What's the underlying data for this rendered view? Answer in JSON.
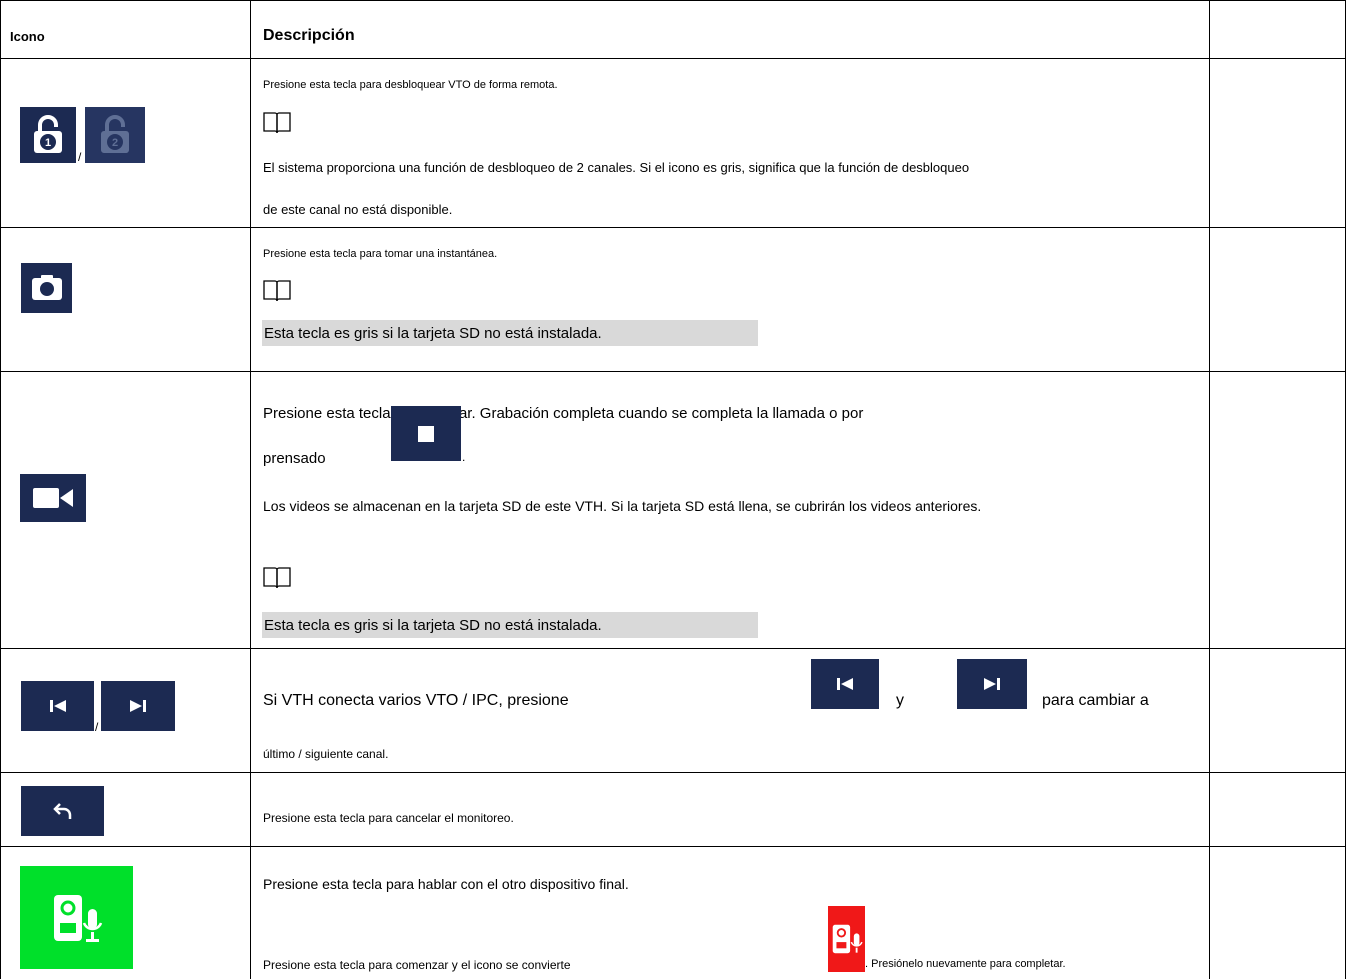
{
  "header": {
    "icon_col": "Icono",
    "desc_col": "Descripción"
  },
  "rows": [
    {
      "sep": "/",
      "lines": [
        "Presione esta tecla para desbloquear VTO de forma remota.",
        "El sistema proporciona una función de desbloqueo de 2 canales. Si el icono es gris, significa que la función de desbloqueo",
        "de este canal no está disponible."
      ],
      "icons": [
        "unlock-1-icon",
        "unlock-2-icon"
      ]
    },
    {
      "lines": [
        "Presione esta tecla para tomar una instantánea.",
        "Esta tecla es gris si la tarjeta SD no está instalada."
      ],
      "icons": [
        "camera-icon"
      ]
    },
    {
      "lines": [
        "Presione esta tecla para grabar. Grabación completa cuando se completa la llamada o por",
        "prensado",
        ".",
        "Los videos se almacenan en la tarjeta SD de este VTH. Si la tarjeta SD está llena, se cubrirán los videos anteriores.",
        "Esta tecla es gris si la tarjeta SD no está instalada."
      ],
      "icons": [
        "video-record-icon",
        "stop-icon"
      ]
    },
    {
      "sep": "/",
      "lines": [
        "Si VTH conecta varios VTO / IPC, presione",
        "y",
        "para cambiar a",
        "último / siguiente canal."
      ],
      "icons": [
        "previous-icon",
        "next-icon"
      ]
    },
    {
      "lines": [
        "Presione esta tecla para cancelar el monitoreo."
      ],
      "icons": [
        "back-icon"
      ]
    },
    {
      "lines": [
        "Presione esta tecla para hablar con el otro dispositivo final.",
        "Presione esta tecla para comenzar y el icono se convierte",
        ". Presiónelo nuevamente para completar."
      ],
      "icons": [
        "talk-icon",
        "talking-icon"
      ]
    }
  ],
  "colors": {
    "icon_bg": "#1c2a52",
    "talk_green": "#00e02a",
    "talk_red": "#f01818",
    "note_gray": "#d9d9d9"
  }
}
